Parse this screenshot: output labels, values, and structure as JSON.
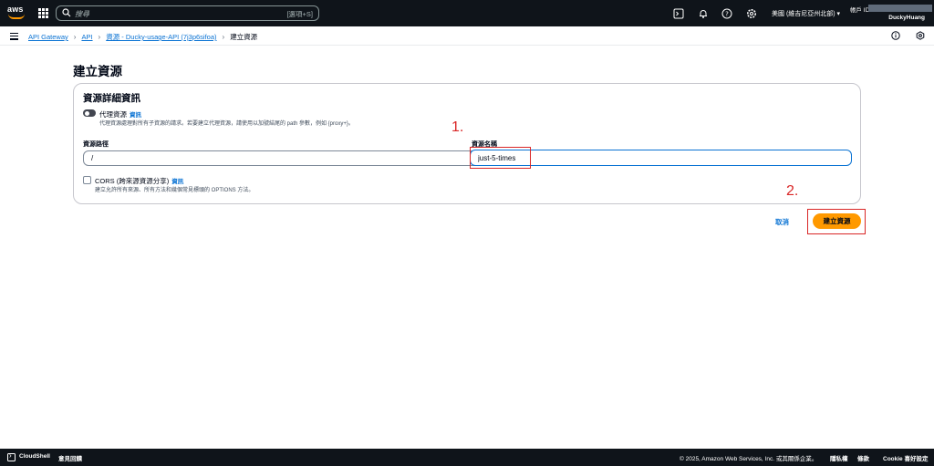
{
  "topbar": {
    "logo_text": "aws",
    "search_placeholder": "搜尋",
    "search_shortcut": "[選項+S]",
    "region": "美國 (維吉尼亞州北部) ▾",
    "account_label": "帳戶 ID:",
    "user": "DuckyHuang"
  },
  "breadcrumb": {
    "items": [
      "API Gateway",
      "API",
      "資源 - Ducky-usage-API (7j3p6sifoa)"
    ],
    "current": "建立資源"
  },
  "page": {
    "title": "建立資源",
    "panel_title": "資源詳細資訊",
    "proxy": {
      "label": "代理資源",
      "info": "資訊",
      "description": "代理資源處理對所有子資源的請求。若要建立代理資源，請使用以加號結尾的 path 參數，例如 {proxy+}。"
    },
    "resource_path": {
      "label": "資源路徑",
      "value": "/"
    },
    "resource_name": {
      "label": "資源名稱",
      "value": "just-5-times"
    },
    "cors": {
      "label": "CORS (跨來源資源分享)",
      "info": "資訊",
      "description": "建立允許所有來源、所有方法和幾個常見標頭的 OPTIONS 方法。"
    },
    "cancel_label": "取消",
    "create_label": "建立資源"
  },
  "annotations": {
    "step1": "1.",
    "step2": "2.",
    "color": "#d92626"
  },
  "footer": {
    "cloudshell": "CloudShell",
    "feedback": "意見回饋",
    "copyright": "© 2025, Amazon Web Services, Inc. 或其關係企業。",
    "privacy": "隱私權",
    "terms": "條款",
    "cookies": "Cookie 喜好設定"
  },
  "colors": {
    "primary_button": "#ff9900",
    "link": "#0972d3",
    "nav_background": "#0f141a"
  }
}
